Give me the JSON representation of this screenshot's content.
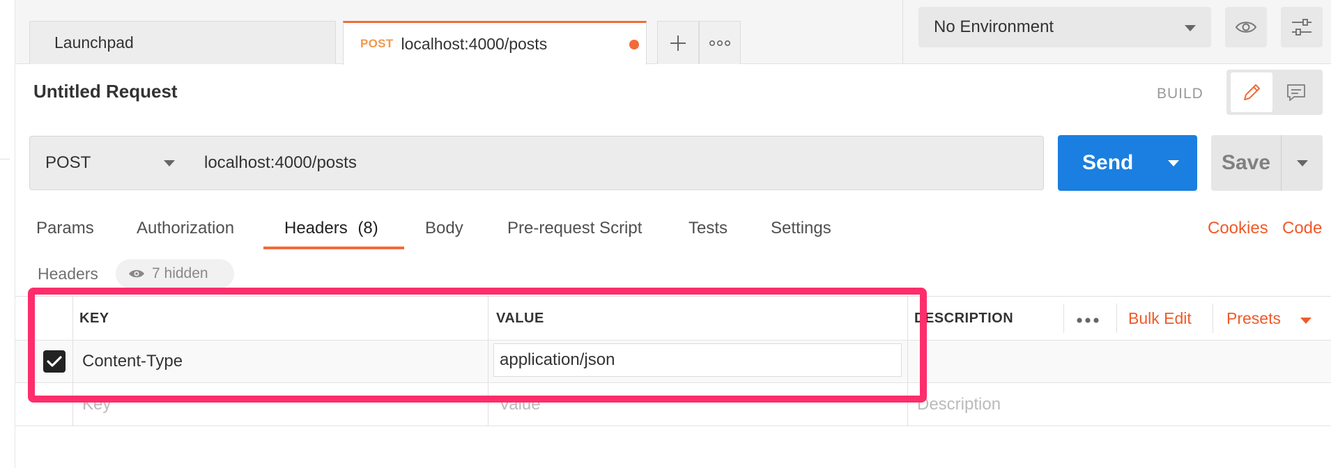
{
  "tabs": {
    "launchpad": "Launchpad",
    "active_method": "POST",
    "active_url": "localhost:4000/posts"
  },
  "environment": {
    "selected": "No Environment"
  },
  "request": {
    "title": "Untitled Request",
    "mode_label": "BUILD",
    "method": "POST",
    "url": "localhost:4000/posts",
    "send_label": "Send",
    "save_label": "Save"
  },
  "request_tabs": {
    "params": "Params",
    "authorization": "Authorization",
    "headers": "Headers",
    "headers_count": "(8)",
    "body": "Body",
    "pre_request": "Pre-request Script",
    "tests": "Tests",
    "settings": "Settings",
    "cookies": "Cookies",
    "code": "Code"
  },
  "headers_section": {
    "label": "Headers",
    "hidden_count": "7 hidden"
  },
  "table": {
    "columns": {
      "key": "KEY",
      "value": "VALUE",
      "description": "DESCRIPTION"
    },
    "bulk_edit": "Bulk Edit",
    "presets": "Presets",
    "rows": [
      {
        "key": "Content-Type",
        "value": "application/json",
        "description": ""
      }
    ],
    "placeholders": {
      "key": "Key",
      "value": "Value",
      "description": "Description"
    }
  },
  "colors": {
    "accent_orange": "#f26b3a",
    "send_blue": "#1a7fe0",
    "highlight_pink": "#ff2d6b"
  },
  "icons": {
    "tab_add": "plus-icon",
    "tab_more": "more-horizontal-icon",
    "env_view": "eye-icon",
    "env_settings": "sliders-icon",
    "mode_edit": "pencil-icon",
    "mode_comment": "comment-icon",
    "hidden_toggle": "eye-icon",
    "row_check": "checkmark-icon"
  }
}
